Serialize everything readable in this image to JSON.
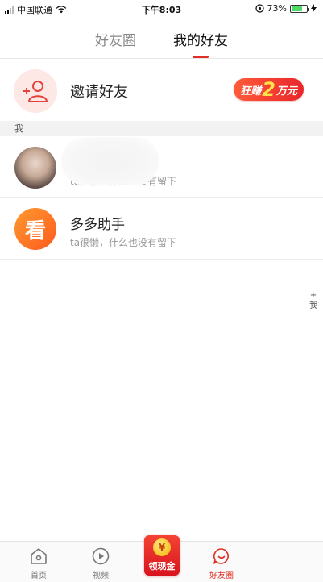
{
  "status_bar": {
    "carrier": "中国联通",
    "time": "下午8:03",
    "battery_percent": "73%",
    "battery_level": 0.73
  },
  "tabs": [
    {
      "label": "好友圈",
      "active": false
    },
    {
      "label": "我的好友",
      "active": true
    }
  ],
  "invite": {
    "label": "邀请好友",
    "badge_prefix": "狂赚",
    "badge_number": "2",
    "badge_suffix": "万元"
  },
  "section_header": "我",
  "friends": [
    {
      "name": "",
      "subtitle": "ta很懒，什么也没有留下",
      "avatar": "photo"
    },
    {
      "name": "多多助手",
      "subtitle": "ta很懒，什么也没有留下",
      "avatar": "看"
    }
  ],
  "side_index": {
    "plus": "+",
    "me": "我"
  },
  "bottom_nav": {
    "home": "首页",
    "video": "视频",
    "cash_coin": "¥",
    "cash": "领现金",
    "friends": "好友圈"
  },
  "colors": {
    "accent": "#e02e24",
    "badge_text": "#ffe14a"
  },
  "icons": [
    "wifi-icon",
    "location-lock-icon",
    "charging-icon",
    "add-user-icon",
    "home-icon",
    "play-icon",
    "friends-chat-icon"
  ]
}
